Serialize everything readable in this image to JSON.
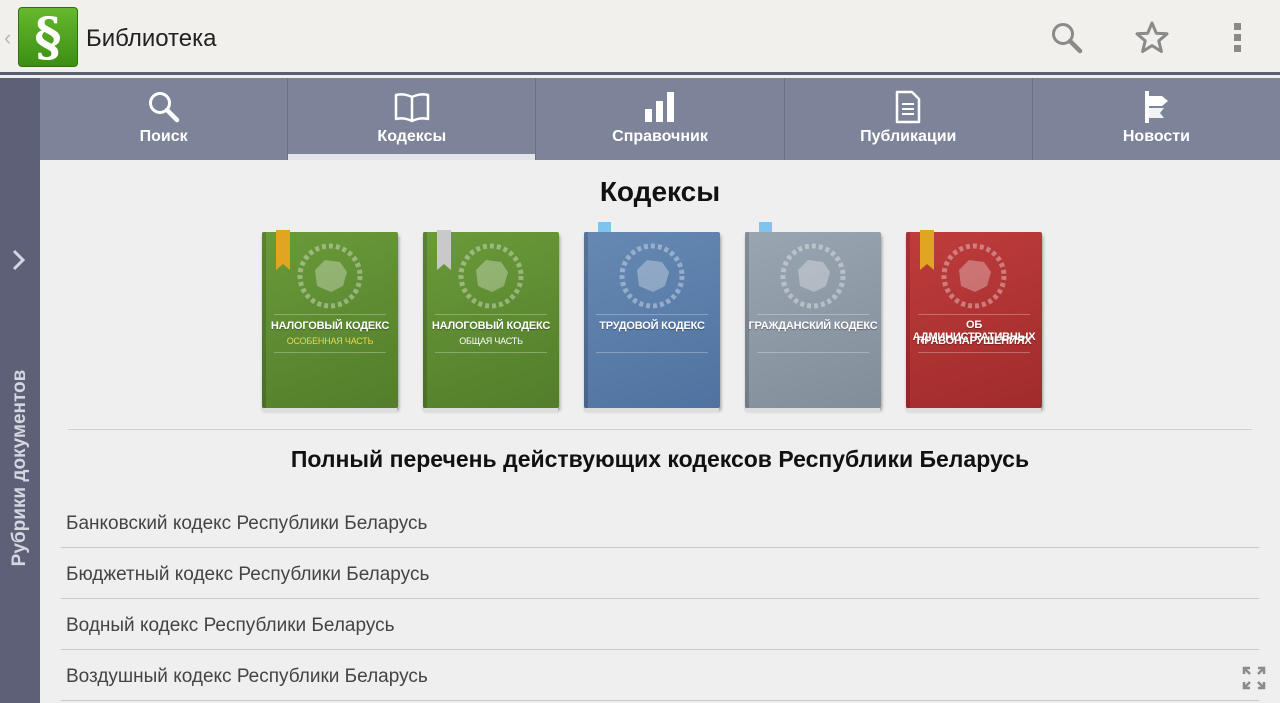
{
  "app": {
    "title": "Библиотека",
    "logo_glyph": "§",
    "back_glyph": "‹"
  },
  "actionbar_icons": [
    "search-icon",
    "star-icon",
    "overflow-menu-icon"
  ],
  "side_panel": {
    "label": "Рубрики документов"
  },
  "tabs": [
    {
      "label": "Поиск",
      "icon": "search-icon",
      "active": false
    },
    {
      "label": "Кодексы",
      "icon": "book-icon",
      "active": true
    },
    {
      "label": "Справочник",
      "icon": "bar-chart-icon",
      "active": false
    },
    {
      "label": "Публикации",
      "icon": "document-icon",
      "active": false
    },
    {
      "label": "Новости",
      "icon": "signpost-icon",
      "active": false
    }
  ],
  "content": {
    "title": "Кодексы",
    "featured_books": [
      {
        "title": "НАЛОГОВЫЙ КОДЕКС",
        "subtitle": "ОСОБЕННАЯ ЧАСТЬ",
        "color": "#5f8c34",
        "subtitle_color": "#e8d84a",
        "bookmark": "gold-ribbon"
      },
      {
        "title": "НАЛОГОВЫЙ КОДЕКС",
        "subtitle": "ОБЩАЯ ЧАСТЬ",
        "color": "#5f8c34",
        "subtitle_color": "#ffffff",
        "bookmark": "silver-ribbon"
      },
      {
        "title": "ТРУДОВОЙ КОДЕКС",
        "subtitle": "",
        "color": "#5a7fa9",
        "subtitle_color": "#ffffff",
        "bookmark": "blue-flag"
      },
      {
        "title": "ГРАЖДАНСКИЙ КОДЕКС",
        "subtitle": "",
        "color": "#8f9aa7",
        "subtitle_color": "#ffffff",
        "bookmark": "blue-flag"
      },
      {
        "title": "ОБ АДМИНИСТРАТИВНЫХ",
        "subtitle": "ПРАВОНАРУШЕНИЯХ",
        "color": "#b23636",
        "subtitle_color": "#ffffff",
        "bookmark": "gold-ribbon"
      }
    ],
    "list_title": "Полный перечень действующих кодексов Республики Беларусь",
    "codes": [
      "Банковский кодекс Республики Беларусь",
      "Бюджетный кодекс Республики Беларусь",
      "Водный кодекс Республики Беларусь",
      "Воздушный кодекс Республики Беларусь"
    ]
  },
  "colors": {
    "tab_bar": "#7d8399",
    "side_rail": "#5d6076",
    "logo_green": "#4da41f"
  }
}
